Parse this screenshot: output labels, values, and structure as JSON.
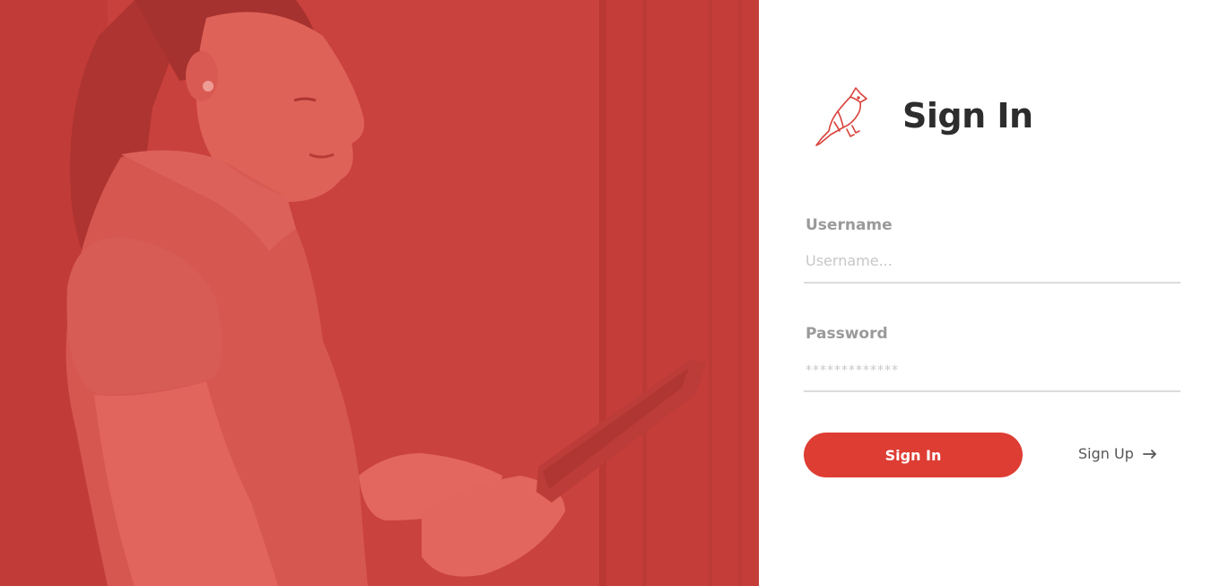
{
  "hero": {
    "image": "woman-with-tablet-photo",
    "overlay_color": "#d8433c"
  },
  "brand": {
    "logo_icon": "cardinal-bird-icon",
    "title": "Sign In"
  },
  "form": {
    "username": {
      "label": "Username",
      "placeholder": "Username..."
    },
    "password": {
      "label": "Password",
      "placeholder": "*************"
    },
    "submit_label": "Sign In",
    "signup_label": "Sign Up",
    "signup_icon": "arrow-right-icon"
  },
  "colors": {
    "accent": "#de3d33",
    "title": "#2d2d2d",
    "label": "#9a9a9a",
    "input_border": "#dcdcdc"
  }
}
